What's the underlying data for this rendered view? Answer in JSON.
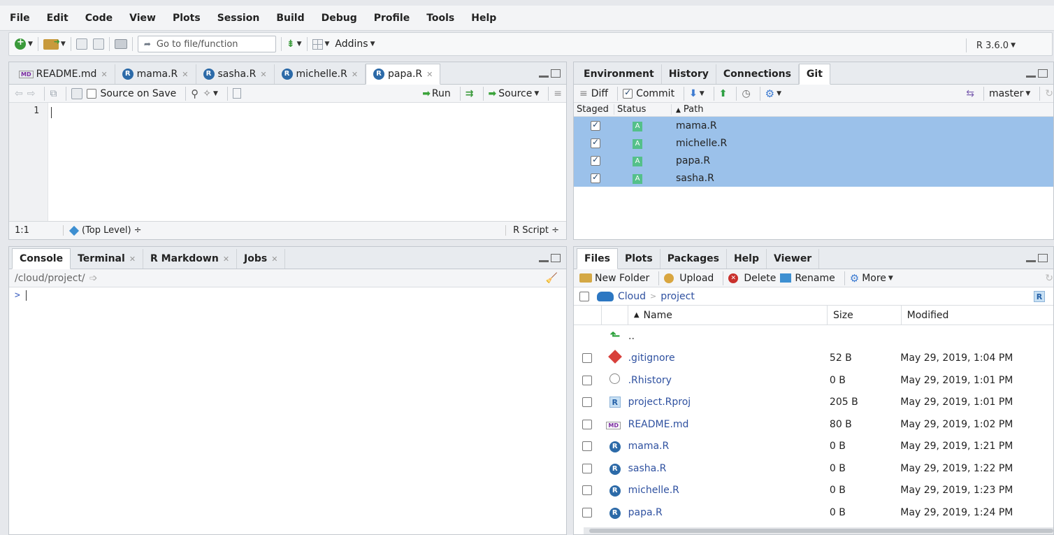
{
  "menubar": [
    "File",
    "Edit",
    "Code",
    "View",
    "Plots",
    "Session",
    "Build",
    "Debug",
    "Profile",
    "Tools",
    "Help"
  ],
  "toolbar": {
    "goto_placeholder": "Go to file/function",
    "addins_label": "Addins",
    "r_version": "R 3.6.0"
  },
  "source": {
    "tabs": [
      {
        "label": "README.md",
        "icon": "md-file-icon"
      },
      {
        "label": "mama.R",
        "icon": "r-file-icon"
      },
      {
        "label": "sasha.R",
        "icon": "r-file-icon"
      },
      {
        "label": "michelle.R",
        "icon": "r-file-icon"
      },
      {
        "label": "papa.R",
        "icon": "r-file-icon"
      }
    ],
    "source_on_save": "Source on Save",
    "run_label": "Run",
    "source_label": "Source",
    "line_number": "1",
    "status_pos": "1:1",
    "status_scope": "(Top Level) ÷",
    "status_type": "R Script ÷"
  },
  "console": {
    "tabs": [
      "Console",
      "Terminal",
      "R Markdown",
      "Jobs"
    ],
    "path": "/cloud/project/",
    "prompt": ">"
  },
  "git": {
    "tabs": [
      "Environment",
      "History",
      "Connections",
      "Git"
    ],
    "diff_label": "Diff",
    "commit_label": "Commit",
    "branch": "master",
    "col_staged": "Staged",
    "col_status": "Status",
    "col_path": "Path",
    "status_letter": "A",
    "rows": [
      "mama.R",
      "michelle.R",
      "papa.R",
      "sasha.R"
    ]
  },
  "files": {
    "tabs": [
      "Files",
      "Plots",
      "Packages",
      "Help",
      "Viewer"
    ],
    "new_folder": "New Folder",
    "upload": "Upload",
    "delete": "Delete",
    "rename": "Rename",
    "more": "More",
    "crumb_root": "Cloud",
    "crumb_sep": ">",
    "crumb_dir": "project",
    "col_name": "Name",
    "col_size": "Size",
    "col_modified": "Modified",
    "parent": "..",
    "rows": [
      {
        "name": ".gitignore",
        "size": "52 B",
        "modified": "May 29, 2019, 1:04 PM",
        "icon": "git-icon"
      },
      {
        "name": ".Rhistory",
        "size": "0 B",
        "modified": "May 29, 2019, 1:01 PM",
        "icon": "history-icon"
      },
      {
        "name": "project.Rproj",
        "size": "205 B",
        "modified": "May 29, 2019, 1:01 PM",
        "icon": "rproj-icon"
      },
      {
        "name": "README.md",
        "size": "80 B",
        "modified": "May 29, 2019, 1:02 PM",
        "icon": "md-file-icon"
      },
      {
        "name": "mama.R",
        "size": "0 B",
        "modified": "May 29, 2019, 1:21 PM",
        "icon": "r-file-icon"
      },
      {
        "name": "sasha.R",
        "size": "0 B",
        "modified": "May 29, 2019, 1:22 PM",
        "icon": "r-file-icon"
      },
      {
        "name": "michelle.R",
        "size": "0 B",
        "modified": "May 29, 2019, 1:23 PM",
        "icon": "r-file-icon"
      },
      {
        "name": "papa.R",
        "size": "0 B",
        "modified": "May 29, 2019, 1:24 PM",
        "icon": "r-file-icon"
      }
    ]
  }
}
